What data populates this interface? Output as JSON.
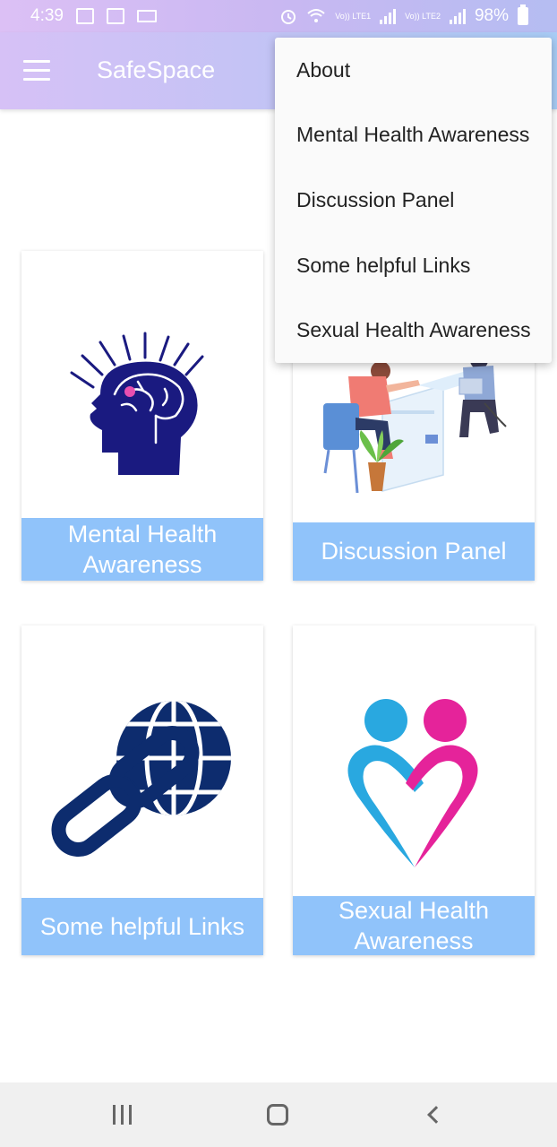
{
  "status_bar": {
    "time": "4:39",
    "volte1": "Vo)) LTE1",
    "volte2": "Vo)) LTE2",
    "battery": "98%",
    "icons": [
      "image-icon",
      "sim-icon",
      "laptop-icon",
      "alarm-icon",
      "wifi-icon",
      "signal-icon",
      "battery-icon"
    ]
  },
  "app_bar": {
    "title": "SafeSpace",
    "menu_icon": "hamburger-menu-icon"
  },
  "dropdown": {
    "items": [
      {
        "label": "About"
      },
      {
        "label": "Mental Health Awareness"
      },
      {
        "label": "Discussion Panel"
      },
      {
        "label": "Some helpful Links"
      },
      {
        "label": "Sexual Health Awareness"
      }
    ]
  },
  "cards": {
    "mental": {
      "label_line1": "Mental Health",
      "label_line2": "Awareness",
      "icon": "brain-head-icon"
    },
    "discussion": {
      "label": "Discussion Panel",
      "icon": "discussion-illustration"
    },
    "links": {
      "label": "Some helpful Links",
      "icon": "globe-link-icon"
    },
    "sexual": {
      "label_line1": "Sexual Health",
      "label_line2": "Awareness",
      "icon": "heart-couple-icon"
    }
  },
  "colors": {
    "card_label_bg": "#90c3fa",
    "navy": "#1a1a80",
    "link_blue": "#0d2c6e",
    "pink": "#e5239a",
    "cyan": "#29a8e0"
  },
  "nav_bar": {
    "icons": [
      "recents-icon",
      "home-icon",
      "back-icon"
    ]
  }
}
